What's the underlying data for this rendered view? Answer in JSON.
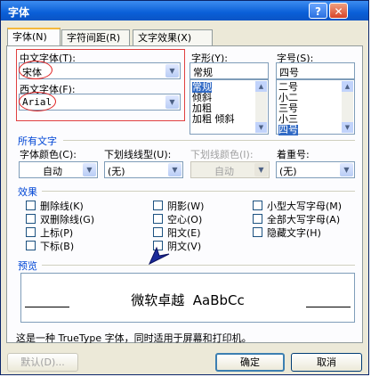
{
  "window": {
    "title": "字体",
    "help_glyph": "?",
    "close_glyph": "✕"
  },
  "tabs": [
    {
      "label": "字体(N)"
    },
    {
      "label": "字符间距(R)"
    },
    {
      "label": "文字效果(X)"
    }
  ],
  "font": {
    "chinese_label": "中文字体(T):",
    "chinese_value": "宋体",
    "western_label": "西文字体(F):",
    "western_value": "Arial",
    "style_label": "字形(Y):",
    "style_value": "常规",
    "style_options": [
      "常规",
      "倾斜",
      "加粗",
      "加粗 倾斜"
    ],
    "size_label": "字号(S):",
    "size_value": "四号",
    "size_options": [
      "二号",
      "小二",
      "三号",
      "小三",
      "四号"
    ]
  },
  "all_text": {
    "section": "所有文字",
    "color_label": "字体颜色(C):",
    "color_value": "自动",
    "underline_label": "下划线线型(U):",
    "underline_value": "(无)",
    "underline_color_label": "下划线颜色(I):",
    "underline_color_value": "自动",
    "emphasis_label": "着重号:",
    "emphasis_value": "(无)"
  },
  "effects": {
    "section": "效果",
    "items": [
      "删除线(K)",
      "双删除线(G)",
      "上标(P)",
      "下标(B)",
      "阴影(W)",
      "空心(O)",
      "阳文(E)",
      "阴文(V)",
      "小型大写字母(M)",
      "全部大写字母(A)",
      "隐藏文字(H)"
    ]
  },
  "preview": {
    "section": "预览",
    "sample": "微软卓越  AaBbCc",
    "note": "这是一种 TrueType 字体，同时适用于屏幕和打印机。"
  },
  "buttons": {
    "default": "默认(D)...",
    "ok": "确定",
    "cancel": "取消"
  },
  "icons": {
    "arrow": "chevron-down-icon",
    "scroll_up": "triangle-up-icon",
    "scroll_down": "triangle-down-icon"
  },
  "colors": {
    "accent": "#0046d5",
    "selection": "#316ac5",
    "annotation": "#e02020"
  }
}
